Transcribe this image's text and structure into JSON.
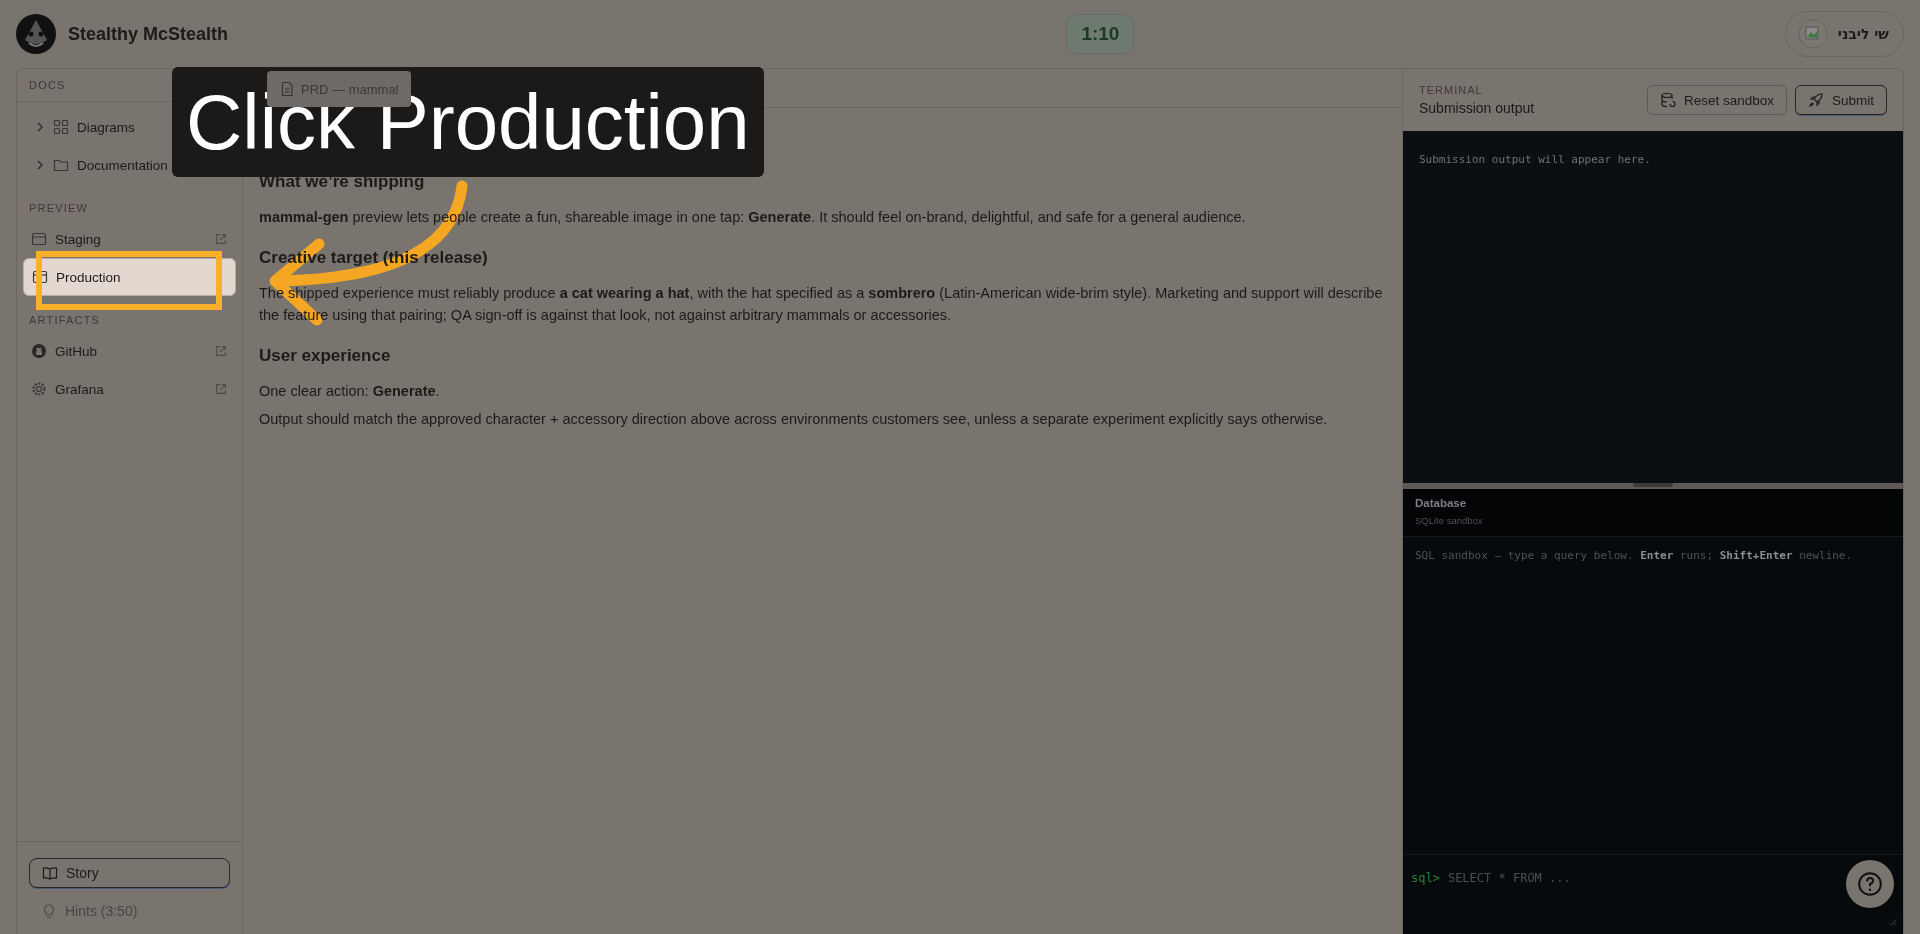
{
  "app": {
    "name": "Stealthy McStealth"
  },
  "timer": "1:10",
  "user": {
    "name": "שי ליבני"
  },
  "sidebar": {
    "sections": [
      {
        "title": "DOCS",
        "items": [
          {
            "kind": "tree",
            "label": "Diagrams",
            "expanded": false
          },
          {
            "kind": "tree",
            "label": "Documentation",
            "expanded": false
          }
        ]
      },
      {
        "title": "PREVIEW",
        "items": [
          {
            "kind": "link",
            "label": "Staging",
            "selected": false
          },
          {
            "kind": "link",
            "label": "Production",
            "selected": true
          }
        ]
      },
      {
        "title": "ARTIFACTS",
        "items": [
          {
            "kind": "link",
            "label": "GitHub",
            "selected": false
          },
          {
            "kind": "link",
            "label": "Grafana",
            "selected": false
          }
        ]
      }
    ],
    "story_button": "Story",
    "hints": "Hints (3:50)"
  },
  "document": {
    "tab": "PRD — mammal",
    "blocks": [
      {
        "kind": "heading",
        "text": "What we’re shipping"
      },
      {
        "kind": "paragraph",
        "text": "**mammal-gen** preview lets people create a fun, shareable image in one tap: **Generate**. It should feel on-brand, delightful, and safe for a general audience."
      },
      {
        "kind": "heading",
        "text": "Creative target (this release)"
      },
      {
        "kind": "paragraph",
        "text": "The shipped experience must reliably produce **a cat wearing a hat**, with the hat specified as a **sombrero** (Latin-American wide-brim style). Marketing and support will describe the feature using that pairing; QA sign-off is against that look, not against arbitrary mammals or accessories."
      },
      {
        "kind": "heading",
        "text": "User experience"
      },
      {
        "kind": "line",
        "text": "One clear action: **Generate**."
      },
      {
        "kind": "line",
        "text": "Output should match the approved character + accessory direction above across environments customers see, unless a separate experiment explicitly says otherwise."
      }
    ]
  },
  "terminal": {
    "label": "TERMINAL",
    "title": "Submission output",
    "reset_button": "Reset sandbox",
    "submit_button": "Submit",
    "output": "Submission output will appear here."
  },
  "database": {
    "title": "Database",
    "subtitle": "SQLite sandbox",
    "hint": "SQL sandbox — type a query below. **Enter** runs; **Shift+Enter** newline.",
    "prompt": "sql>",
    "placeholder": "SELECT * FROM ..."
  },
  "tutorial": {
    "callout": "Click Production"
  }
}
